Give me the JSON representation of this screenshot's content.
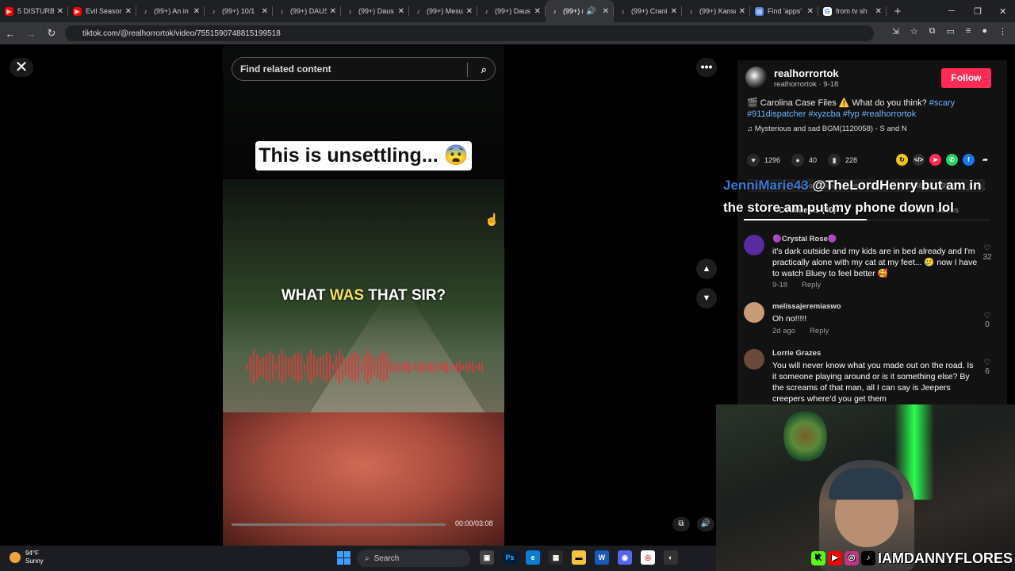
{
  "tabs": [
    {
      "title": "5 DISTURB",
      "icon": "youtube-icon"
    },
    {
      "title": "Evil Season",
      "icon": "youtube-icon"
    },
    {
      "title": "(99+) An in",
      "icon": "tiktok-icon"
    },
    {
      "title": "(99+) 10/1",
      "icon": "tiktok-icon"
    },
    {
      "title": "(99+) DAUS",
      "icon": "tiktok-icon"
    },
    {
      "title": "(99+) Daus",
      "icon": "tiktok-icon"
    },
    {
      "title": "(99+) Mesu",
      "icon": "tiktok-icon"
    },
    {
      "title": "(99+) Daus",
      "icon": "tiktok-icon"
    },
    {
      "title": "(99+) re",
      "icon": "tiktok-icon"
    },
    {
      "title": "(99+) Crani",
      "icon": "tiktok-icon"
    },
    {
      "title": "(99+) Kansa",
      "icon": "tiktok-icon"
    },
    {
      "title": "Find 'apps'",
      "icon": "doc-icon"
    },
    {
      "title": "from tv sh",
      "icon": "google-icon"
    }
  ],
  "new_tab": "+",
  "address": {
    "url": "tiktok.com/@realhorrortok/video/7551590748815199518"
  },
  "search": {
    "placeholder": "Find related content"
  },
  "video": {
    "caption_top": "This is unsettling... 😨",
    "caption_pre": "WHAT ",
    "caption_hl": "WAS",
    "caption_post": " THAT SIR?",
    "time": "00:00/03:08",
    "progress_fraction": 0.0
  },
  "author": {
    "name": "realhorrortok",
    "sub": "realhorrortok · 9-18",
    "follow": "Follow"
  },
  "description": {
    "pre": "🎬 Carolina Case Files ⚠️ What do you think? ",
    "tags": [
      "#scary",
      "#911dispatcher",
      "#xyzcba",
      "#fyp",
      "#realhorrortok"
    ]
  },
  "music": "♫  Mysterious and sad BGM(1120058) - S and N",
  "stats": {
    "likes": "1296",
    "comments": "40",
    "saves": "228"
  },
  "link": "https://www.tiktok.com/@realhorrortok/video/7551590748815199518?is_from_webapp=1",
  "panel_tabs": {
    "comments": "Comments (40)",
    "creator": "Creator videos"
  },
  "overlay": {
    "name": "JenniMarie43",
    "text": " @TheLordHenry but am in the store am put my phone down lol"
  },
  "comments": [
    {
      "name": "🟣Crystal Rose🟣",
      "text": "it's dark outside and my kids are in bed already and I'm practically alone with my cat at my feet... 🥲 now I have to watch Bluey to feel better 🥰",
      "date": "9-18",
      "reply": "Reply",
      "likes": "32",
      "avatar_color": "#5a2aa0"
    },
    {
      "name": "melissajeremiaswo",
      "text": "Oh no!!!!!",
      "date": "2d ago",
      "reply": "Reply",
      "likes": "0",
      "avatar_color": "#c89a78"
    },
    {
      "name": "Lorrie Grazes",
      "text": "You will never know what you made out on the road. Is it someone playing around or is it something else? By the screams of that man, all I can say is Jeepers creepers where'd you get them",
      "date": "",
      "reply": "",
      "likes": "6",
      "avatar_color": "#6a4a3a"
    }
  ],
  "streamer": {
    "handle": "IAMDANNYFLORES"
  },
  "taskbar": {
    "temp": "94°F",
    "cond": "Sunny",
    "search": "Search"
  },
  "colors": {
    "follow": "#fe2c55",
    "tag": "#6eb4ff",
    "highlight": "#f2e35a"
  }
}
